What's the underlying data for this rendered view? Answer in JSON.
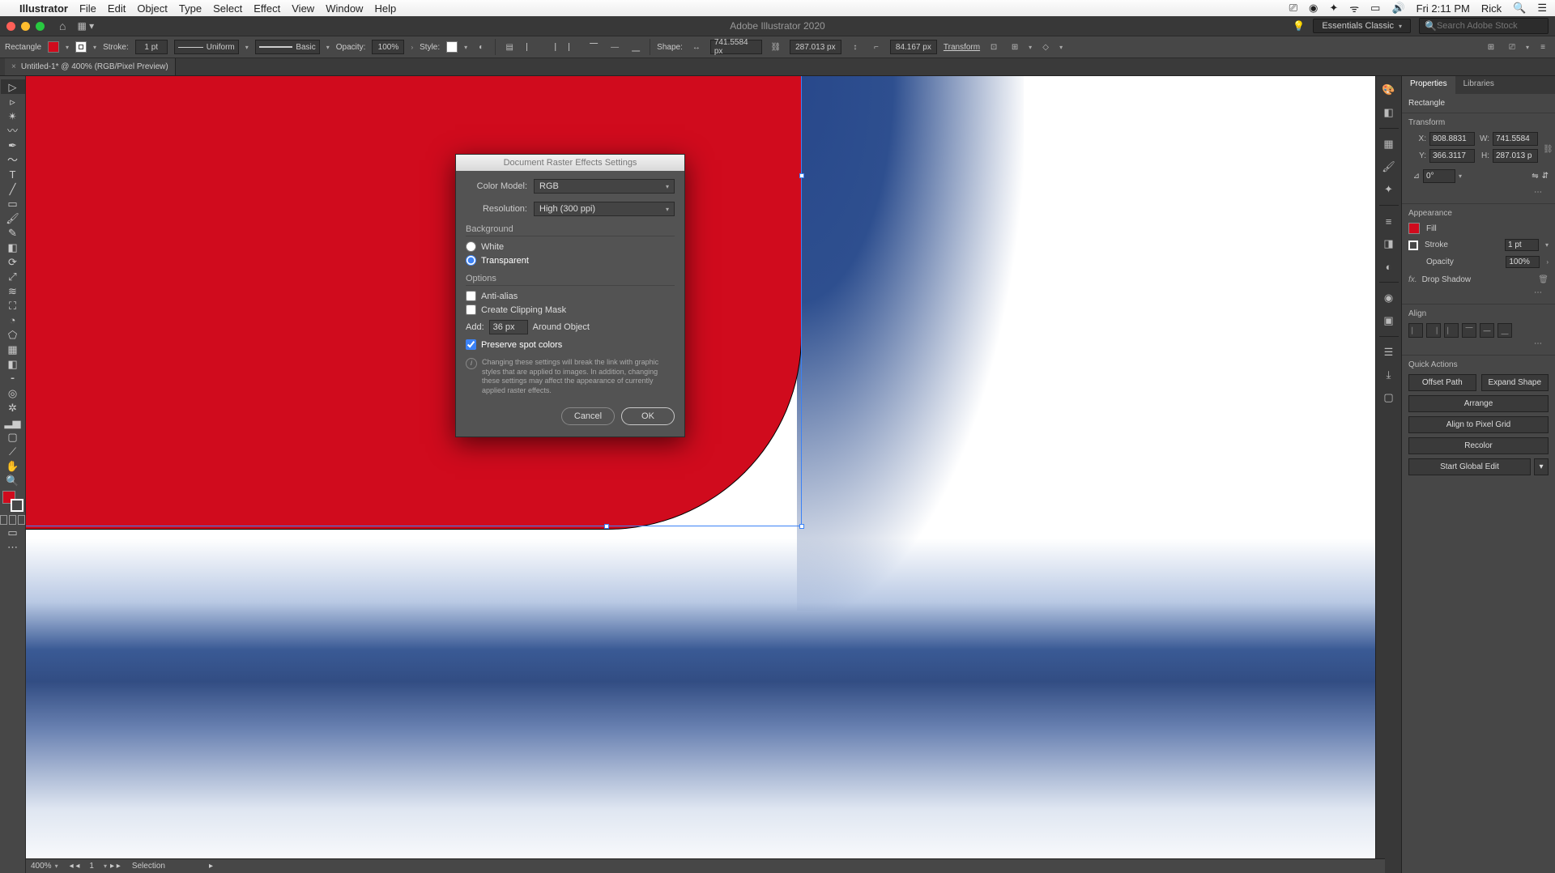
{
  "mac_menu": {
    "app": "Illustrator",
    "items": [
      "File",
      "Edit",
      "Object",
      "Type",
      "Select",
      "Effect",
      "View",
      "Window",
      "Help"
    ],
    "clock": "Fri 2:11 PM",
    "user": "Rick"
  },
  "titlebar": {
    "title": "Adobe Illustrator 2020",
    "workspace": "Essentials Classic",
    "search_placeholder": "Search Adobe Stock"
  },
  "control": {
    "shape_label": "Rectangle",
    "fill_color": "#d00b1d",
    "stroke_label": "Stroke:",
    "stroke_weight": "1 pt",
    "profile": "Uniform",
    "brush": "Basic",
    "opacity_label": "Opacity:",
    "opacity_value": "100%",
    "style_label": "Style:",
    "shape_w_label": "Shape:",
    "w_value": "741.5584 px",
    "h_value": "287.013 px",
    "corner_value": "84.167 px",
    "transform_label": "Transform"
  },
  "doc_tab": {
    "label": "Untitled-1* @ 400% (RGB/Pixel Preview)"
  },
  "status": {
    "zoom": "400%",
    "artboard": "1",
    "mode": "Selection"
  },
  "props": {
    "tab_properties": "Properties",
    "tab_libraries": "Libraries",
    "object_type": "Rectangle",
    "transform_h": "Transform",
    "x": "808.8831",
    "y": "366.3117",
    "w": "741.5584",
    "h": "287.013 p",
    "angle": "0°",
    "appearance_h": "Appearance",
    "fill_label": "Fill",
    "stroke_label": "Stroke",
    "stroke_val": "1 pt",
    "opacity_label": "Opacity",
    "opacity_val": "100%",
    "effect_label": "Drop Shadow",
    "align_h": "Align",
    "qa_h": "Quick Actions",
    "qa_offset": "Offset Path",
    "qa_expand": "Expand Shape",
    "qa_arrange": "Arrange",
    "qa_pixel": "Align to Pixel Grid",
    "qa_recolor": "Recolor",
    "qa_global": "Start Global Edit"
  },
  "dialog": {
    "title": "Document Raster Effects Settings",
    "color_model_label": "Color Model:",
    "color_model_value": "RGB",
    "resolution_label": "Resolution:",
    "resolution_value": "High (300 ppi)",
    "background_h": "Background",
    "bg_white": "White",
    "bg_transparent": "Transparent",
    "options_h": "Options",
    "anti_alias": "Anti-alias",
    "clip_mask": "Create Clipping Mask",
    "add_label": "Add:",
    "add_value": "36 px",
    "add_suffix": "Around Object",
    "preserve": "Preserve spot colors",
    "info": "Changing these settings will break the link with graphic styles that are applied to images. In addition, changing these settings may affect the appearance of currently applied raster effects.",
    "cancel": "Cancel",
    "ok": "OK"
  }
}
